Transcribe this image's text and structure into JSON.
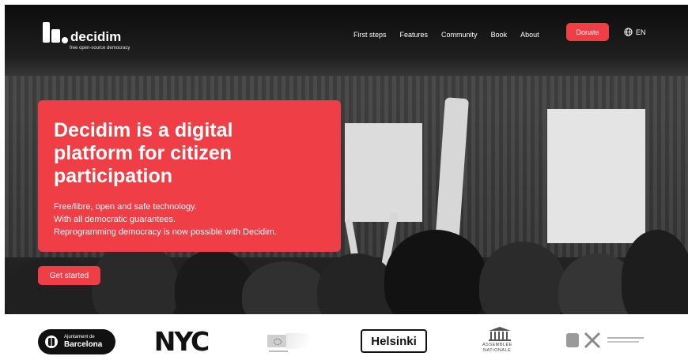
{
  "brand": {
    "name": "decidim",
    "tagline": "free open-source democracy"
  },
  "nav": {
    "items": [
      "First steps",
      "Features",
      "Community",
      "Book",
      "About"
    ],
    "donate_label": "Donate",
    "language_label": "EN",
    "language_icon": "globe-icon"
  },
  "hero": {
    "headline": "Decidim is a digital platform for citizen participation",
    "lines": [
      "Free/libre, open and safe technology.",
      "With all democratic guarantees.",
      "Reprogramming democracy is now possible with Decidim."
    ],
    "cta_label": "Get started"
  },
  "partners": {
    "barcelona_line1": "Ajuntament de",
    "barcelona_line2": "Barcelona",
    "nyc": "NYC",
    "helsinki": "Helsinki",
    "assemblee_line1": "ASSEMBLÉE",
    "assemblee_line2": "NATIONALE"
  },
  "colors": {
    "accent": "#ef3e45",
    "hero_dark": "#1f1f1f"
  }
}
